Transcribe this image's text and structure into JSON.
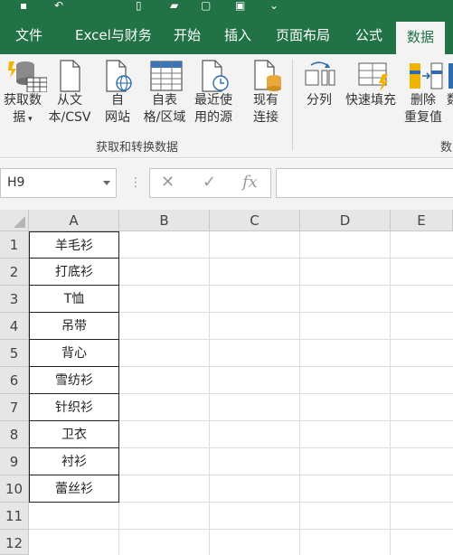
{
  "quick_access": {
    "icons": [
      "save-icon",
      "undo-icon",
      "new-file-icon",
      "open-icon",
      "print-preview-icon",
      "print-icon",
      "customize-dropdown-icon"
    ]
  },
  "ribbon_tabs": [
    {
      "label": "文件"
    },
    {
      "label": "Excel与财务"
    },
    {
      "label": "开始"
    },
    {
      "label": "插入"
    },
    {
      "label": "页面布局"
    },
    {
      "label": "公式"
    },
    {
      "label": "数据",
      "active": true
    }
  ],
  "ribbon": {
    "get_data": {
      "line1": "获取数",
      "line2": "据"
    },
    "from_text": {
      "line1": "从文",
      "line2": "本/CSV"
    },
    "from_web": {
      "line1": "自",
      "line2": "网站"
    },
    "from_table": {
      "line1": "自表",
      "line2": "格/区域"
    },
    "recent_sources": {
      "line1": "最近使",
      "line2": "用的源"
    },
    "existing_connections": {
      "line1": "现有",
      "line2": "连接"
    },
    "group_get_transform": "获取和转换数据",
    "split": "分列",
    "flash_fill": "快速填充",
    "remove_duplicates": {
      "line1": "删除",
      "line2": "重复值"
    },
    "cut_label": "数",
    "group_data_tools_partial": "数"
  },
  "formula_bar": {
    "name_box": "H9",
    "cancel_symbol": "✕",
    "enter_symbol": "✓",
    "fx_symbol": "fx",
    "formula": ""
  },
  "sheet": {
    "columns": [
      "A",
      "B",
      "C",
      "D",
      "E"
    ],
    "rows": [
      "1",
      "2",
      "3",
      "4",
      "5",
      "6",
      "7",
      "8",
      "9",
      "10",
      "11",
      "12"
    ],
    "column_a_values": [
      "羊毛衫",
      "打底衫",
      "T恤",
      "吊带",
      "背心",
      "雪纺衫",
      "针织衫",
      "卫衣",
      "衬衫",
      "蕾丝衫"
    ]
  },
  "colors": {
    "excel_green": "#217346",
    "ribbon_bg": "#f3f3f3"
  }
}
